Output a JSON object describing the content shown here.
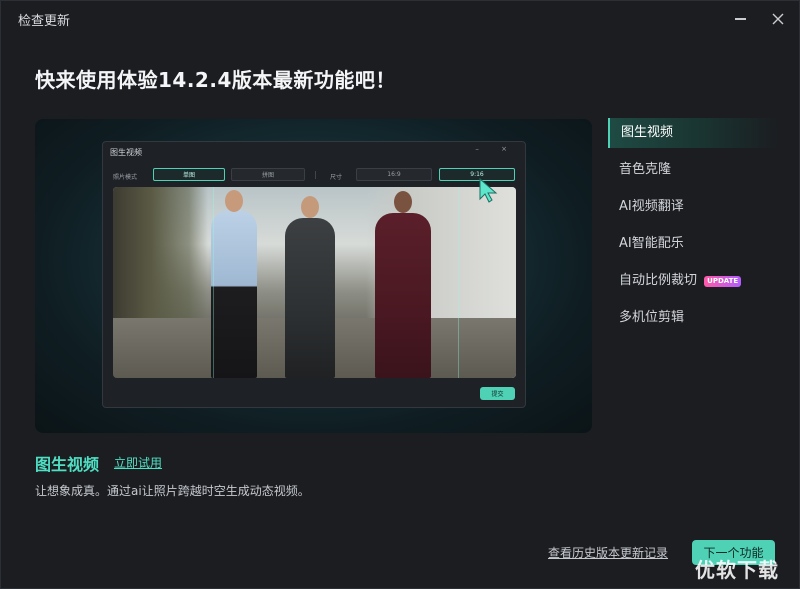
{
  "window": {
    "title": "检查更新"
  },
  "headline": "快来使用体验14.2.4版本最新功能吧！",
  "preview": {
    "window_title": "图生视频",
    "window_controls": "– ×",
    "photo_mode_label": "照片模式",
    "mode_single": "单图",
    "mode_collage": "拼图",
    "size_label": "尺寸",
    "ratio_16_9": "16:9",
    "ratio_9_16": "9:16",
    "submit_label": "提交"
  },
  "sidebar": {
    "items": [
      {
        "label": "图生视频",
        "active": true
      },
      {
        "label": "音色克隆"
      },
      {
        "label": "AI视频翻译"
      },
      {
        "label": "AI智能配乐"
      },
      {
        "label": "自动比例裁切",
        "badge": "UPDATE"
      },
      {
        "label": "多机位剪辑"
      }
    ]
  },
  "feature": {
    "title": "图生视频",
    "try_link": "立即试用",
    "description": "让想象成真。通过ai让照片跨越时空生成动态视频。"
  },
  "footer": {
    "history_link": "查看历史版本更新记录",
    "next_button": "下一个功能"
  },
  "watermark": "优软下载",
  "colors": {
    "accent": "#4fd1b6",
    "background": "#1b1d21",
    "badge_from": "#ff5aa8",
    "badge_to": "#b35cff"
  }
}
